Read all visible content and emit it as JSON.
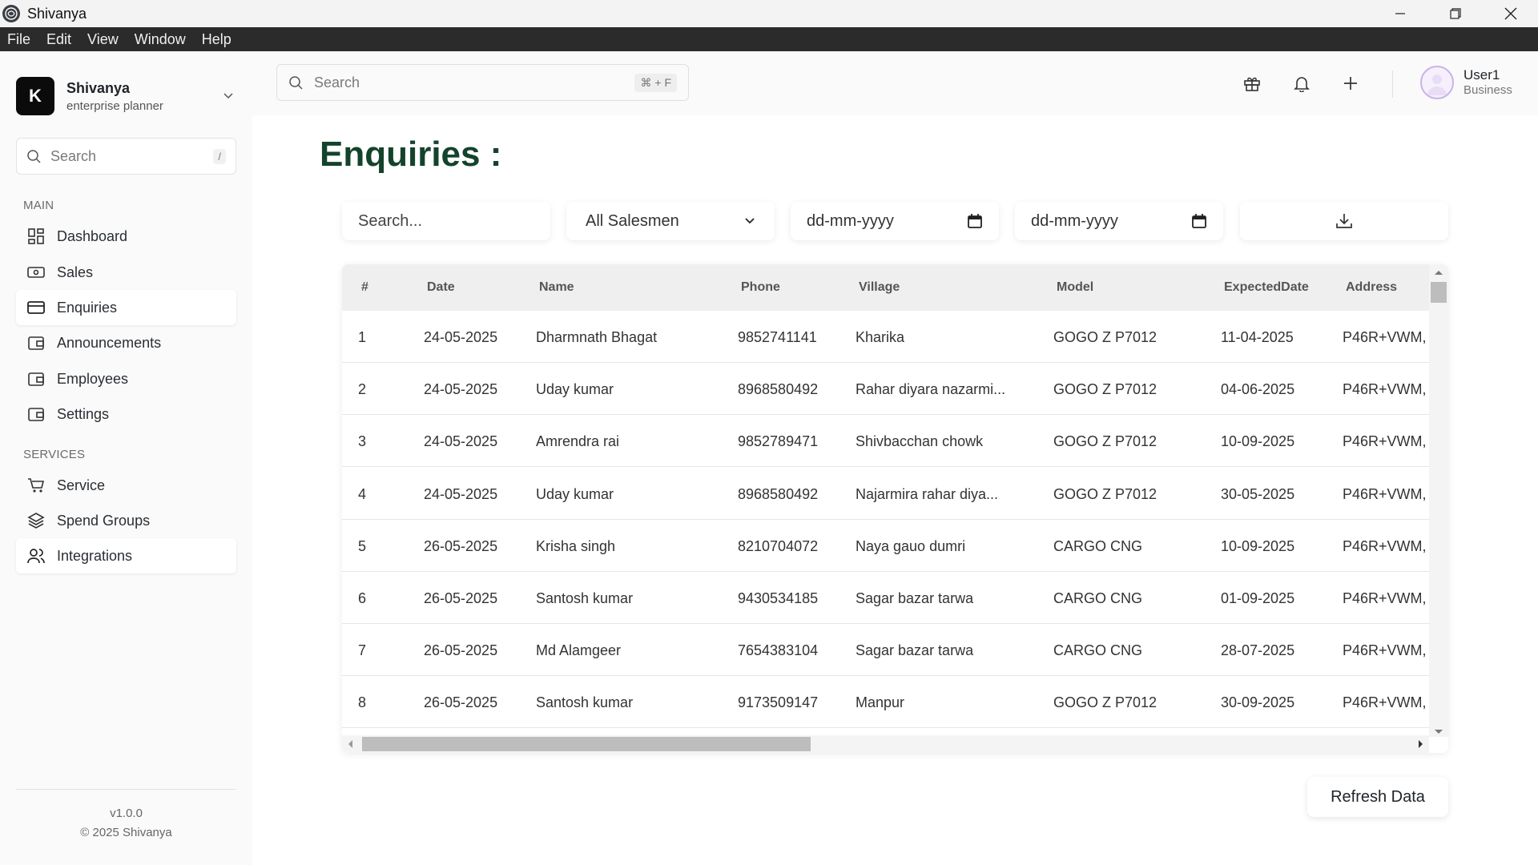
{
  "window": {
    "title": "Shivanya"
  },
  "menu": [
    "File",
    "Edit",
    "View",
    "Window",
    "Help"
  ],
  "brand": {
    "logo_letter": "K",
    "name": "Shivanya",
    "subtitle": "enterprise planner"
  },
  "sidebar": {
    "search_placeholder": "Search",
    "search_shortcut": "/",
    "main_label": "MAIN",
    "main_items": [
      {
        "label": "Dashboard",
        "icon": "dashboard-icon"
      },
      {
        "label": "Sales",
        "icon": "cash-icon"
      },
      {
        "label": "Enquiries",
        "icon": "card-icon",
        "active": true
      },
      {
        "label": "Announcements",
        "icon": "wallet-icon"
      },
      {
        "label": "Employees",
        "icon": "wallet-icon"
      },
      {
        "label": "Settings",
        "icon": "wallet-icon"
      }
    ],
    "services_label": "SERVICES",
    "service_items": [
      {
        "label": "Service",
        "icon": "cart-icon"
      },
      {
        "label": "Spend Groups",
        "icon": "layers-icon"
      },
      {
        "label": "Integrations",
        "icon": "users-icon",
        "active": true
      }
    ],
    "version": "v1.0.0",
    "copyright": "© 2025 Shivanya"
  },
  "header": {
    "search_placeholder": "Search",
    "search_shortcut": "⌘ + F",
    "user": {
      "name": "User1",
      "role": "Business"
    }
  },
  "page": {
    "title": "Enquiries :",
    "filters": {
      "search_placeholder": "Search...",
      "salesman_selected": "All Salesmen",
      "date_from_placeholder": "dd-mm-yyyy",
      "date_to_placeholder": "dd-mm-yyyy"
    },
    "table": {
      "columns": [
        "#",
        "Date",
        "Name",
        "Phone",
        "Village",
        "Model",
        "ExpectedDate",
        "Address"
      ],
      "rows": [
        [
          "1",
          "24-05-2025",
          "Dharmnath Bhagat",
          "9852741141",
          "Kharika",
          "GOGO Z P7012",
          "11-04-2025",
          "P46R+VWM,"
        ],
        [
          "2",
          "24-05-2025",
          "Uday kumar",
          "8968580492",
          "Rahar diyara nazarmi...",
          "GOGO Z P7012",
          "04-06-2025",
          "P46R+VWM,"
        ],
        [
          "3",
          "24-05-2025",
          "Amrendra rai",
          "9852789471",
          "Shivbacchan chowk",
          "GOGO Z P7012",
          "10-09-2025",
          "P46R+VWM,"
        ],
        [
          "4",
          "24-05-2025",
          "Uday kumar",
          "8968580492",
          "Najarmira rahar diya...",
          "GOGO Z P7012",
          "30-05-2025",
          "P46R+VWM,"
        ],
        [
          "5",
          "26-05-2025",
          "Krisha singh",
          "8210704072",
          "Naya gauo dumri",
          "CARGO CNG",
          "10-09-2025",
          "P46R+VWM,"
        ],
        [
          "6",
          "26-05-2025",
          "Santosh kumar",
          "9430534185",
          "Sagar bazar tarwa",
          "CARGO CNG",
          "01-09-2025",
          "P46R+VWM,"
        ],
        [
          "7",
          "26-05-2025",
          "Md Alamgeer",
          "7654383104",
          "Sagar bazar tarwa",
          "CARGO CNG",
          "28-07-2025",
          "P46R+VWM,"
        ],
        [
          "8",
          "26-05-2025",
          "Santosh kumar",
          "9173509147",
          "Manpur",
          "GOGO Z P7012",
          "30-09-2025",
          "P46R+VWM,"
        ]
      ]
    },
    "refresh_label": "Refresh Data"
  },
  "colors": {
    "title": "#14432c",
    "menubar": "#2b2b2b",
    "table_header": "#efefef"
  }
}
